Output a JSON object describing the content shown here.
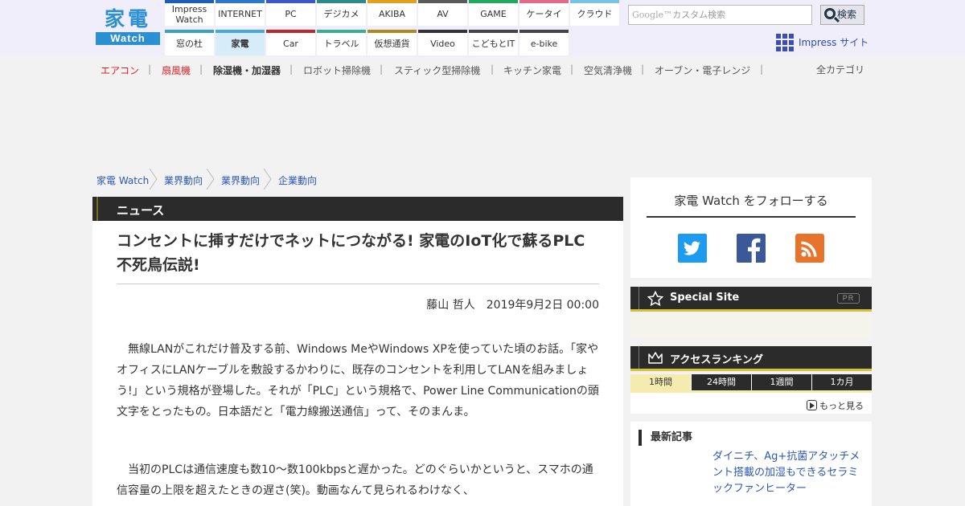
{
  "logo": {
    "kanji": "家電",
    "sub": "Watch"
  },
  "site_nav": [
    {
      "label": "Impress\nWatch",
      "color": "#1e5fb4"
    },
    {
      "label": "INTERNET",
      "color": "#2d78c8"
    },
    {
      "label": "PC",
      "color": "#3d56c8"
    },
    {
      "label": "デジカメ",
      "color": "#2d8a8a"
    },
    {
      "label": "AKIBA",
      "color": "#e0a020"
    },
    {
      "label": "AV",
      "color": "#5a5a5a"
    },
    {
      "label": "GAME",
      "color": "#22a85a"
    },
    {
      "label": "ケータイ",
      "color": "#e46a8a"
    },
    {
      "label": "クラウド",
      "color": "#79c2e6"
    },
    {
      "label": "窓の杜",
      "color": "#3aa0c8"
    },
    {
      "label": "家電",
      "color": "#47a8e0"
    },
    {
      "label": "Car",
      "color": "#c02828"
    },
    {
      "label": "トラベル",
      "color": "#38b090"
    },
    {
      "label": "仮想通貨",
      "color": "#b08820"
    },
    {
      "label": "Video",
      "color": "#333333"
    },
    {
      "label": "こどもとIT",
      "color": "#444444"
    },
    {
      "label": "e-bike",
      "color": "#444444"
    }
  ],
  "search": {
    "brand": "Google™",
    "placeholder": "カスタム検索",
    "button": "検索"
  },
  "impress_link": "Impress サイト",
  "categories": [
    {
      "label": "エアコン",
      "color": "#d8232a"
    },
    {
      "label": "扇風機",
      "color": "#d8232a"
    },
    {
      "label": "除湿機・加湿器",
      "color": "#333333"
    },
    {
      "label": "ロボット掃除機",
      "color": "#555555"
    },
    {
      "label": "スティック型掃除機",
      "color": "#555555"
    },
    {
      "label": "キッチン家電",
      "color": "#555555"
    },
    {
      "label": "空気清浄機",
      "color": "#555555"
    },
    {
      "label": "オーブン・電子レンジ",
      "color": "#555555"
    }
  ],
  "all_categories": "全カテゴリ",
  "breadcrumb": [
    "家電 Watch",
    "業界動向",
    "業界動向",
    "企業動向"
  ],
  "article": {
    "label": "ニュース",
    "title": "コンセントに挿すだけでネットにつながる! 家電のIoT化で蘇るPLC不死鳥伝説!",
    "author": "藤山 哲人",
    "date": "2019年9月2日 00:00",
    "paragraphs": [
      "無線LANがこれだけ普及する前、Windows MeやWindows XPを使っていた頃のお話。「家やオフィスにLANケーブルを敷設するかわりに、既存のコンセントを利用してLANを組みましょう!」という規格が登場した。それが「PLC」という規格で、Power Line Communicationの頭文字をとったもの。日本語だと「電力線搬送通信」って、そのまんま。",
      "当初のPLCは通信速度も数10～数100kbpsと遅かった。どのぐらいかというと、スマホの通信容量の上限を超えたときの遅さ(笑)。動画なんて見られるわけなく、"
    ]
  },
  "follow": {
    "title": "家電 Watch をフォローする",
    "twitter_color": "#1d9bf0",
    "facebook_color": "#3b5998",
    "rss_color": "#e8742b"
  },
  "special_site": {
    "title": "Special Site",
    "badge": "PR"
  },
  "ranking": {
    "title": "アクセスランキング",
    "tabs": [
      "1時間",
      "24時間",
      "1週間",
      "1カ月"
    ],
    "more": "もっと見る"
  },
  "latest": {
    "title": "最新記事",
    "item": "ダイニチ、Ag+抗菌アタッチメント搭載の加湿もできるセラミックファンヒーター"
  }
}
